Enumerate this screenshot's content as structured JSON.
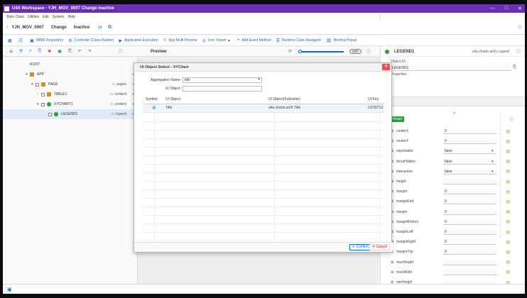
{
  "window": {
    "title": "U4A Workspace - YJH_MOV_0007 Change Inactive",
    "controls": [
      "—",
      "□",
      "✕"
    ]
  },
  "menu": {
    "items": [
      "Style Class",
      "Utilities",
      "Edit",
      "System",
      "Help"
    ],
    "tcode_placeholder": "SAP T-CODE"
  },
  "header": {
    "id": "YJH_MOV_0007",
    "mode": "Change",
    "state": "Inactive"
  },
  "toolbar": {
    "items": [
      {
        "label": "MIME Repository",
        "icon": "folder-icon"
      },
      {
        "label": "Controller (Class Builder)",
        "icon": "controller-icon"
      },
      {
        "label": "Application Execution",
        "icon": "execute-icon"
      },
      {
        "label": "App Multi Preview",
        "icon": "preview-icon"
      },
      {
        "label": "Icon Viewer",
        "icon": "icon-viewer-icon"
      },
      {
        "label": "Add Event Method",
        "icon": "add-icon"
      },
      {
        "label": "Runtime Class Navigator",
        "icon": "class-navigator-icon"
      },
      {
        "label": "Binding Popup",
        "icon": "binding-icon"
      }
    ]
  },
  "tree": {
    "nodes": [
      {
        "label": "ROOT",
        "agg": "",
        "level": 0,
        "expander": ""
      },
      {
        "label": "APP",
        "agg": "",
        "level": 1,
        "expander": "▾"
      },
      {
        "label": "PAGE",
        "agg": "pages",
        "level": 2,
        "expander": "▾"
      },
      {
        "label": "TABLE1",
        "agg": "content",
        "level": 3,
        "expander": "›"
      },
      {
        "label": "XYCHART1",
        "agg": "content",
        "level": 3,
        "expander": "▾"
      },
      {
        "label": "LEGEND1",
        "agg": "legend",
        "level": 4,
        "expander": ""
      }
    ]
  },
  "preview": {
    "title": "Preview",
    "switch": "OFF"
  },
  "properties": {
    "object": "LEGEND1",
    "class": "u4a.charts.am5.Legend",
    "id_label": "Object ID",
    "id_value": "LEGEND1",
    "section": "Properties",
    "reset_label": "Reset",
    "rows": [
      {
        "name": "centerX",
        "value": "0",
        "kind": "input"
      },
      {
        "name": "centerY",
        "value": "0",
        "kind": "input"
      },
      {
        "name": "exportable",
        "value": "false",
        "kind": "select"
      },
      {
        "name": "forceHidden",
        "value": "false",
        "kind": "select"
      },
      {
        "name": "interactive",
        "value": "false",
        "kind": "select"
      },
      {
        "name": "height",
        "value": "",
        "kind": "input"
      },
      {
        "name": "margin",
        "value": "0",
        "kind": "input"
      },
      {
        "name": "marginEnd",
        "value": "0",
        "kind": "input"
      },
      {
        "name": "margin",
        "value": "0",
        "kind": "input"
      },
      {
        "name": "marginBottom",
        "value": "0",
        "kind": "input"
      },
      {
        "name": "marginLeft",
        "value": "0",
        "kind": "input"
      },
      {
        "name": "marginRight",
        "value": "0",
        "kind": "input"
      },
      {
        "name": "marginTop",
        "value": "0",
        "kind": "input"
      },
      {
        "name": "maxHeight",
        "value": "",
        "kind": "input"
      },
      {
        "name": "maxWidth",
        "value": "",
        "kind": "input"
      },
      {
        "name": "minHeight",
        "value": "",
        "kind": "input"
      },
      {
        "name": "minWidth",
        "value": "",
        "kind": "input"
      }
    ]
  },
  "dialog": {
    "title": "UI Object Select - XYChart",
    "aggregation_label": "Aggregation Name:",
    "aggregation_value": "title",
    "uiobject_label": "UI Object:",
    "uiobject_value": "",
    "columns": [
      "Symbol",
      "UI Object",
      "UI Object(Fullname)",
      "UI Key"
    ],
    "rows": [
      {
        "symbol": "▤",
        "object": "Title",
        "fullname": "u4a.charts.am5.Title",
        "key": "UC00713"
      }
    ],
    "confirm_label": "Confirm",
    "cancel_label": "Cancel"
  },
  "colors": {
    "brand": "#6b2fb3",
    "accent": "#0a6ed1",
    "danger": "#e05353"
  }
}
